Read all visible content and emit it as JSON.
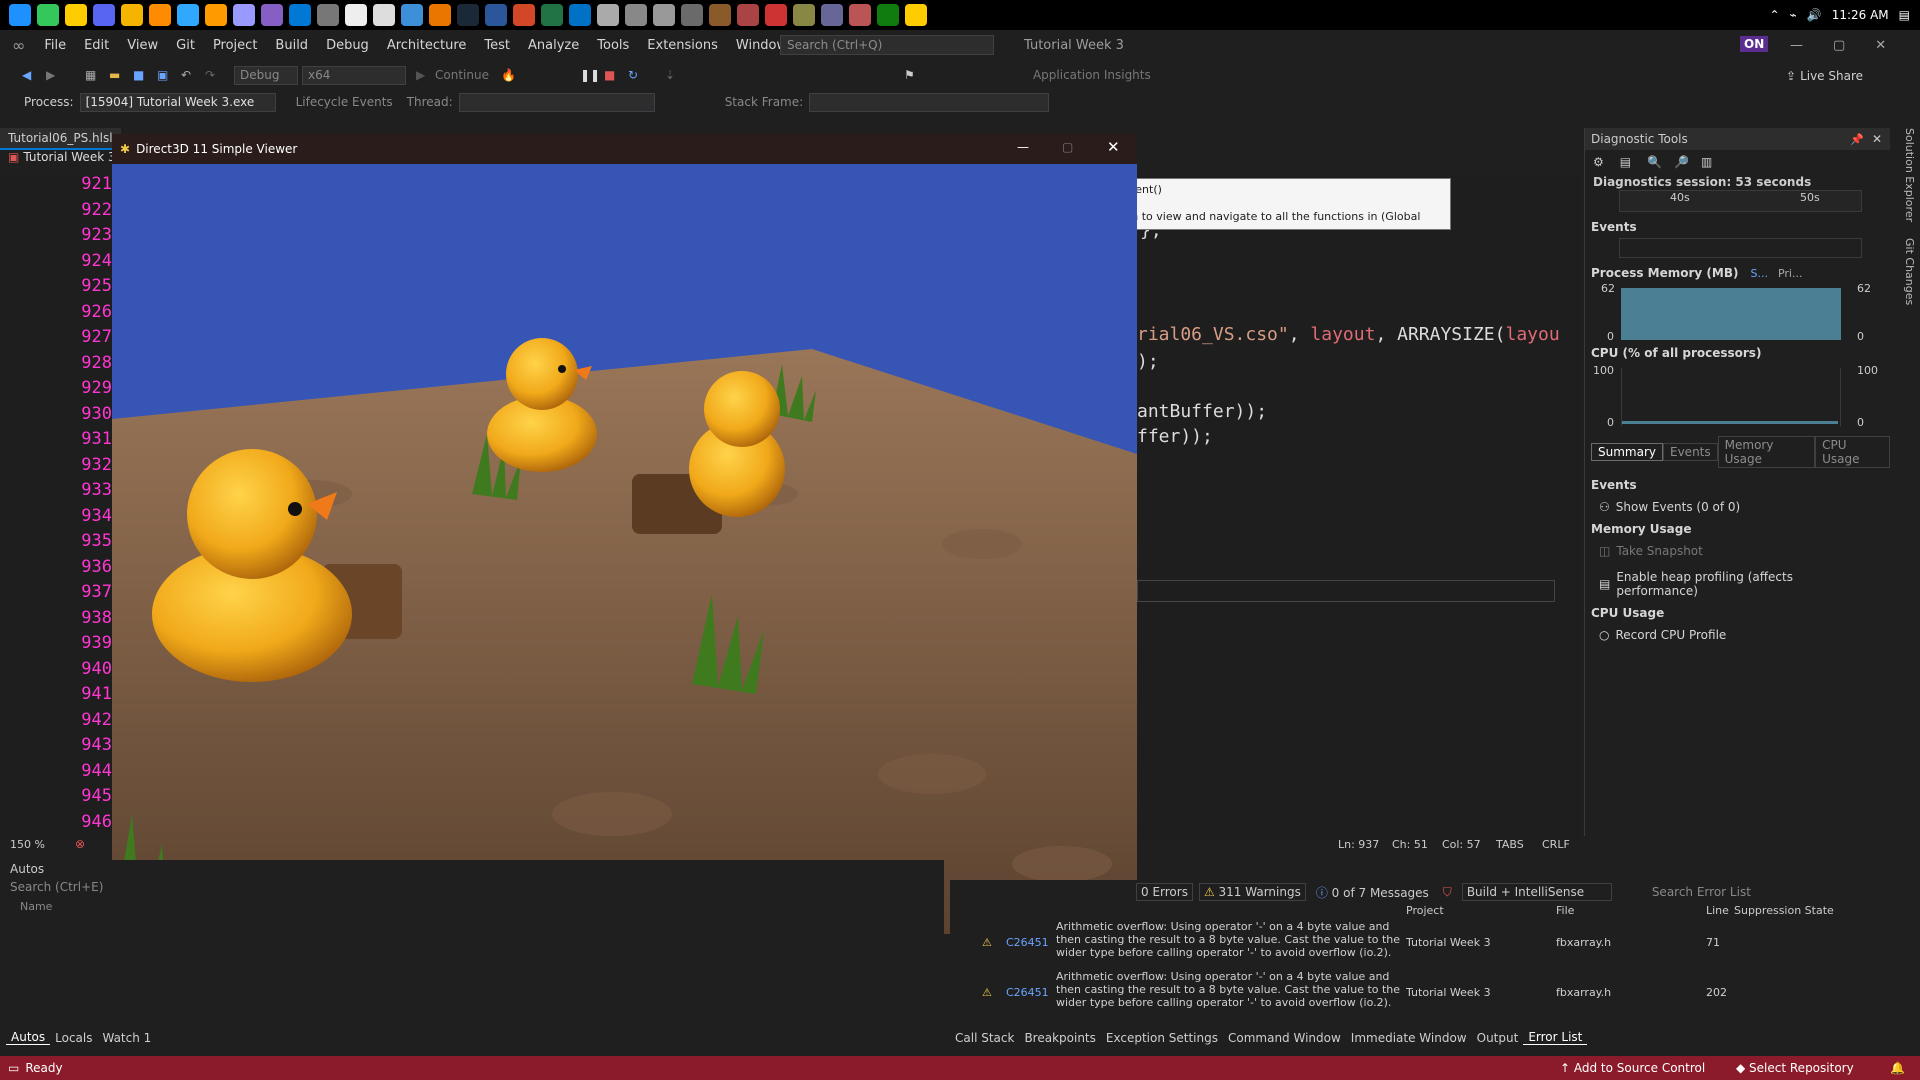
{
  "taskbar": {
    "time": "11:26 AM",
    "icons": [
      "windows-icon",
      "search-icon",
      "edge-icon",
      "chrome-icon",
      "discord-icon",
      "file-explorer-icon",
      "vlc-icon",
      "photoshop-icon",
      "illustrator-icon",
      "aftereffects-icon",
      "visual-studio-icon",
      "store-icon",
      "unreal-icon",
      "unity-icon",
      "maya-icon",
      "blender-icon",
      "steam-icon",
      "word-icon",
      "powerpoint-icon",
      "excel-icon",
      "outlook-icon",
      "obs-icon",
      "app-icon",
      "app-icon",
      "app-icon",
      "app-icon",
      "app-icon",
      "app-icon",
      "app-icon",
      "app-icon",
      "app-icon",
      "xbox-icon",
      "vs-icon"
    ]
  },
  "menubar": {
    "items": [
      "File",
      "Edit",
      "View",
      "Git",
      "Project",
      "Build",
      "Debug",
      "Architecture",
      "Test",
      "Analyze",
      "Tools",
      "Extensions",
      "Window",
      "Help"
    ],
    "search_placeholder": "Search (Ctrl+Q)",
    "window_title": "Tutorial Week 3",
    "user_initials": "ON"
  },
  "toolbar": {
    "config": "Debug",
    "platform": "x64",
    "continue_label": "Continue",
    "app_insights": "Application Insights",
    "live_share": "Live Share"
  },
  "processbar": {
    "process_label": "Process:",
    "process_value": "[15904] Tutorial Week 3.exe",
    "lifecycle_label": "Lifecycle Events",
    "thread_label": "Thread:",
    "stack_frame_label": "Stack Frame:"
  },
  "editor": {
    "tabs": [
      "Tutorial06_PS.hlsl",
      "Tutorial Week 3"
    ],
    "line_numbers": [
      "921",
      "922",
      "923",
      "924",
      "925",
      "926",
      "927",
      "928",
      "929",
      "930",
      "931",
      "932",
      "933",
      "934",
      "935",
      "936",
      "937",
      "938",
      "939",
      "940",
      "941",
      "942",
      "943",
      "944",
      "945",
      "946"
    ],
    "code": {
      "l924": "};",
      "l927_str": "rial06_VS.cso\"",
      "l927_a": ", ",
      "l927_kw": "layout",
      "l927_b": ", ARRAYSIZE(",
      "l927_kw2": "layou",
      "l928": ");",
      "l930": "antBuffer));",
      "l931": "ffer));"
    },
    "zoom": "150 %",
    "status": {
      "ln": "Ln: 937",
      "ch": "Ch: 51",
      "col": "Col: 57",
      "tabs": "TABS",
      "eol": "CRLF"
    }
  },
  "tooltip": {
    "title": "Function: InitContent()",
    "body": "Use the dropdown to view and navigate to all the functions in (Global Scope)."
  },
  "d3d": {
    "title": "Direct3D 11 Simple Viewer"
  },
  "diagnostics": {
    "title": "Diagnostic Tools",
    "session": "Diagnostics session: 53 seconds",
    "timeline_ticks": [
      "40s",
      "50s"
    ],
    "events_label": "Events",
    "memory_label": "Process Memory (MB)",
    "memory_legend": [
      "S...",
      "Pri..."
    ],
    "memory_max": "62",
    "memory_min": "0",
    "cpu_label": "CPU (% of all processors)",
    "cpu_max": "100",
    "cpu_min": "0",
    "tabs": [
      "Summary",
      "Events",
      "Memory Usage",
      "CPU Usage"
    ],
    "summary": {
      "events_header": "Events",
      "show_events": "Show Events (0 of 0)",
      "memory_header": "Memory Usage",
      "take_snapshot": "Take Snapshot",
      "heap_profiling": "Enable heap profiling (affects performance)",
      "cpu_header": "CPU Usage",
      "record_cpu": "Record CPU Profile"
    }
  },
  "autos": {
    "title": "Autos",
    "search_placeholder": "Search (Ctrl+E)",
    "column_name": "Name",
    "tabs": [
      "Autos",
      "Locals",
      "Watch 1"
    ]
  },
  "errorlist": {
    "errors": "0 Errors",
    "warnings": "311 Warnings",
    "messages": "0 of 7 Messages",
    "filter": "Build + IntelliSense",
    "search_placeholder": "Search Error List",
    "columns": [
      "Project",
      "File",
      "Line",
      "Suppression State"
    ],
    "rows": [
      {
        "code": "C26451",
        "desc": "Arithmetic overflow: Using operator '-' on a 4 byte value and then casting the result to a 8 byte value. Cast the value to the wider type before calling operator '-' to avoid overflow (io.2).",
        "project": "Tutorial Week 3",
        "file": "fbxarray.h",
        "line": "71"
      },
      {
        "code": "C26451",
        "desc": "Arithmetic overflow: Using operator '-' on a 4 byte value and then casting the result to a 8 byte value. Cast the value to the wider type before calling operator '-' to avoid overflow (io.2).",
        "project": "Tutorial Week 3",
        "file": "fbxarray.h",
        "line": "202"
      }
    ],
    "tabs": [
      "Call Stack",
      "Breakpoints",
      "Exception Settings",
      "Command Window",
      "Immediate Window",
      "Output",
      "Error List"
    ]
  },
  "statusbar": {
    "ready": "Ready",
    "source_control": "Add to Source Control",
    "repository": "Select Repository"
  },
  "colors": {
    "accent": "#8b1b2a",
    "line_number": "#ff36d1",
    "sky": "#3655b5"
  }
}
